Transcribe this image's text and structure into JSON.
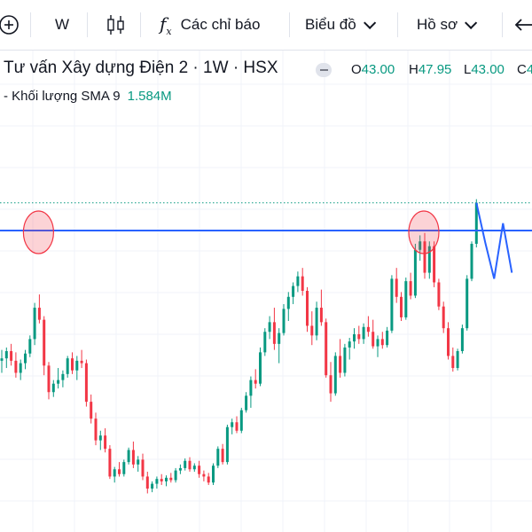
{
  "toolbar": {
    "interval": "W",
    "indicators_label": "Các chỉ báo",
    "chart_type_label": "Biểu đồ",
    "profile_label": "Hồ sơ",
    "fx_glyph": "f",
    "fx_sub": "x",
    "plus_glyph": "+"
  },
  "legend": {
    "symbol_title": "Tư vấn Xây dựng Điện 2 · 1W · HSX",
    "o_label": "O",
    "o_value": "43.00",
    "h_label": "H",
    "h_value": "47.95",
    "l_label": "L",
    "l_value": "43.00",
    "c_label": "C",
    "c_value": "4",
    "volume_label": "- Khối lượng SMA 9",
    "volume_value": "1.584M"
  },
  "colors": {
    "up": "#089981",
    "down": "#f23645",
    "line": "#2962ff"
  },
  "chart_data": {
    "type": "candlestick",
    "title": "Tư vấn Xây dựng Điện 2 · 1W · HSX",
    "ohlc": [
      [
        14.2,
        15.1,
        13.2,
        14.4
      ],
      [
        14.4,
        15.3,
        13.6,
        15.0
      ],
      [
        15.0,
        15.6,
        13.8,
        14.2
      ],
      [
        14.2,
        14.9,
        12.8,
        13.2
      ],
      [
        13.2,
        14.3,
        12.6,
        14.0
      ],
      [
        14.0,
        15.1,
        13.5,
        14.8
      ],
      [
        14.8,
        16.3,
        14.5,
        16.0
      ],
      [
        16.0,
        19.0,
        15.5,
        18.6
      ],
      [
        18.6,
        19.7,
        17.3,
        17.6
      ],
      [
        17.6,
        17.9,
        13.0,
        13.8
      ],
      [
        13.8,
        14.1,
        11.0,
        11.6
      ],
      [
        11.6,
        12.6,
        11.2,
        12.3
      ],
      [
        12.3,
        13.6,
        11.9,
        12.6
      ],
      [
        12.6,
        13.4,
        12.0,
        13.1
      ],
      [
        13.1,
        14.6,
        12.8,
        14.4
      ],
      [
        14.4,
        14.9,
        13.1,
        13.4
      ],
      [
        13.4,
        14.6,
        12.6,
        14.2
      ],
      [
        14.2,
        15.1,
        13.6,
        14.0
      ],
      [
        14.0,
        14.3,
        10.4,
        10.8
      ],
      [
        10.8,
        11.4,
        9.0,
        9.4
      ],
      [
        9.4,
        9.9,
        7.2,
        7.6
      ],
      [
        7.6,
        8.4,
        6.8,
        8.0
      ],
      [
        8.0,
        8.6,
        6.6,
        6.9
      ],
      [
        6.9,
        7.2,
        4.4,
        4.6
      ],
      [
        4.6,
        5.4,
        4.1,
        5.2
      ],
      [
        5.2,
        5.8,
        4.6,
        4.8
      ],
      [
        4.8,
        6.0,
        4.6,
        5.8
      ],
      [
        5.8,
        7.0,
        5.6,
        6.8
      ],
      [
        6.8,
        7.5,
        5.3,
        5.6
      ],
      [
        5.6,
        6.3,
        5.0,
        6.0
      ],
      [
        6.0,
        6.5,
        4.3,
        4.6
      ],
      [
        4.6,
        5.0,
        3.2,
        3.6
      ],
      [
        3.6,
        4.2,
        3.3,
        4.0
      ],
      [
        4.0,
        4.6,
        3.6,
        4.4
      ],
      [
        4.4,
        4.8,
        3.9,
        4.2
      ],
      [
        4.2,
        4.7,
        3.8,
        4.5
      ],
      [
        4.5,
        4.9,
        4.1,
        4.3
      ],
      [
        4.3,
        5.3,
        4.1,
        5.1
      ],
      [
        5.1,
        5.6,
        4.8,
        5.3
      ],
      [
        5.3,
        6.1,
        5.1,
        5.9
      ],
      [
        5.9,
        6.2,
        5.0,
        5.2
      ],
      [
        5.2,
        5.7,
        5.0,
        5.5
      ],
      [
        5.5,
        5.9,
        4.5,
        4.8
      ],
      [
        4.8,
        5.1,
        4.2,
        4.6
      ],
      [
        4.6,
        4.9,
        3.9,
        4.1
      ],
      [
        4.1,
        5.7,
        3.9,
        5.5
      ],
      [
        5.5,
        7.1,
        5.3,
        6.9
      ],
      [
        6.9,
        7.3,
        5.6,
        5.8
      ],
      [
        5.8,
        8.9,
        5.6,
        8.7
      ],
      [
        8.7,
        9.4,
        8.1,
        9.1
      ],
      [
        9.1,
        9.6,
        8.2,
        8.4
      ],
      [
        8.4,
        10.3,
        8.2,
        10.1
      ],
      [
        10.1,
        11.6,
        9.9,
        11.3
      ],
      [
        11.3,
        12.9,
        10.3,
        12.6
      ],
      [
        12.6,
        13.5,
        11.9,
        12.3
      ],
      [
        12.3,
        15.3,
        12.1,
        14.9
      ],
      [
        14.9,
        16.9,
        14.6,
        16.6
      ],
      [
        16.6,
        17.9,
        16.0,
        17.4
      ],
      [
        17.4,
        18.6,
        15.1,
        15.6
      ],
      [
        15.6,
        16.9,
        14.0,
        16.5
      ],
      [
        16.5,
        18.9,
        16.3,
        18.5
      ],
      [
        18.5,
        19.9,
        17.5,
        19.5
      ],
      [
        19.5,
        20.7,
        18.9,
        20.4
      ],
      [
        20.4,
        21.6,
        19.9,
        21.2
      ],
      [
        21.2,
        21.9,
        19.6,
        20.0
      ],
      [
        20.0,
        20.3,
        16.6,
        17.1
      ],
      [
        17.1,
        18.3,
        15.5,
        16.3
      ],
      [
        16.3,
        19.1,
        15.9,
        18.6
      ],
      [
        18.6,
        20.1,
        17.1,
        17.4
      ],
      [
        17.4,
        17.7,
        12.8,
        13.0
      ],
      [
        13.0,
        14.1,
        10.8,
        11.5
      ],
      [
        11.5,
        14.9,
        11.3,
        14.6
      ],
      [
        14.6,
        16.0,
        12.8,
        13.2
      ],
      [
        13.2,
        15.6,
        12.9,
        15.3
      ],
      [
        15.3,
        16.1,
        14.3,
        15.8
      ],
      [
        15.8,
        16.9,
        15.2,
        16.4
      ],
      [
        16.4,
        17.1,
        15.6,
        16.0
      ],
      [
        16.0,
        17.3,
        15.6,
        17.0
      ],
      [
        17.0,
        17.9,
        16.2,
        16.6
      ],
      [
        16.6,
        17.6,
        15.2,
        15.4
      ],
      [
        15.4,
        16.3,
        14.5,
        16.0
      ],
      [
        16.0,
        16.6,
        15.2,
        15.5
      ],
      [
        15.5,
        17.0,
        15.3,
        16.7
      ],
      [
        16.7,
        21.3,
        16.5,
        21.0
      ],
      [
        21.0,
        21.9,
        19.0,
        19.5
      ],
      [
        19.5,
        19.9,
        17.5,
        17.8
      ],
      [
        17.8,
        21.1,
        17.6,
        20.8
      ],
      [
        20.8,
        21.5,
        19.3,
        19.6
      ],
      [
        19.6,
        23.9,
        19.4,
        23.4
      ],
      [
        23.4,
        24.6,
        22.5,
        24.1
      ],
      [
        24.1,
        24.8,
        21.0,
        21.5
      ],
      [
        21.5,
        24.1,
        21.0,
        23.7
      ],
      [
        23.7,
        24.1,
        20.3,
        20.7
      ],
      [
        20.7,
        21.0,
        18.4,
        18.7
      ],
      [
        18.7,
        19.1,
        16.5,
        16.9
      ],
      [
        16.9,
        17.4,
        14.3,
        14.6
      ],
      [
        14.6,
        15.3,
        13.3,
        13.6
      ],
      [
        13.6,
        15.2,
        13.4,
        15.0
      ],
      [
        15.0,
        17.2,
        14.8,
        16.9
      ],
      [
        16.9,
        21.3,
        16.7,
        21.0
      ],
      [
        21.0,
        24.1,
        20.8,
        23.9
      ],
      [
        23.9,
        27.6,
        23.6,
        27.3
      ]
    ],
    "projection": [
      27.3,
      24.0,
      21.0,
      25.6,
      21.5
    ],
    "resistance_level": 25.0,
    "last_price_marker": 27.3,
    "ylim": [
      0,
      40
    ],
    "highlights": [
      "previous high",
      "recent high"
    ]
  }
}
